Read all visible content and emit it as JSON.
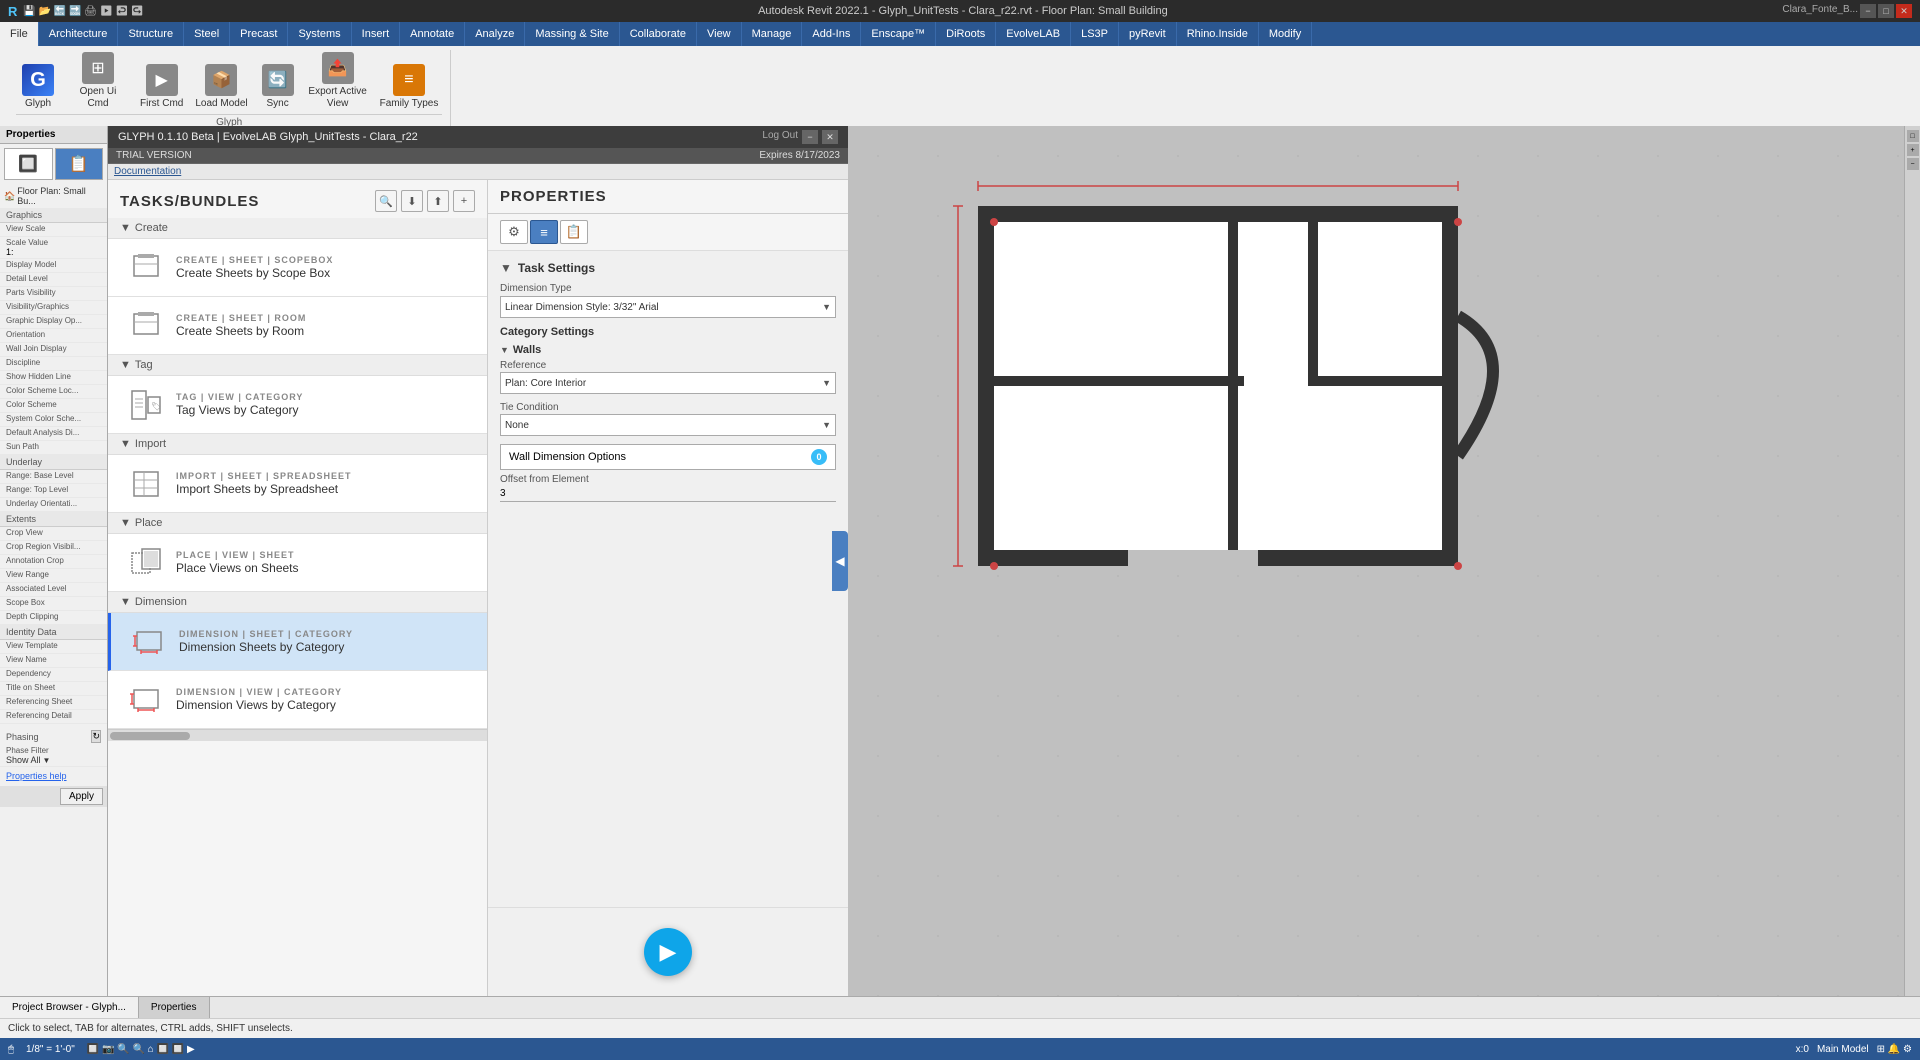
{
  "titlebar": {
    "title": "Autodesk Revit 2022.1 - Glyph_UnitTests - Clara_r22.rvt - Floor Plan: Small Building",
    "min_label": "−",
    "max_label": "□",
    "close_label": "✕",
    "user_label": "Clara_Fonte_B..."
  },
  "ribbon": {
    "tabs": [
      "File",
      "Architecture",
      "Structure",
      "Steel",
      "Precast",
      "Systems",
      "Insert",
      "Annotate",
      "Analyze",
      "Massing & Site",
      "Collaborate",
      "View",
      "Manage",
      "Add-Ins",
      "Enscape™",
      "DiRoots",
      "EvolveLAB",
      "LS3P",
      "pyRevit",
      "Rhino.Inside",
      "Modify"
    ],
    "active_tab": "File",
    "groups": [
      {
        "name": "Glyph",
        "items": [
          {
            "label": "Glyph",
            "icon": "G",
            "color": "blue"
          },
          {
            "label": "Open Ui Cmd",
            "icon": "⊞",
            "color": "gray"
          },
          {
            "label": "First Cmd",
            "icon": "▶",
            "color": "gray"
          },
          {
            "label": "Load Model",
            "icon": "📦",
            "color": "gray"
          },
          {
            "label": "Sync",
            "icon": "🔄",
            "color": "gray"
          },
          {
            "label": "Export Active View",
            "icon": "📤",
            "color": "gray"
          },
          {
            "label": "Family Types",
            "icon": "≡",
            "color": "orange"
          }
        ]
      }
    ]
  },
  "glyph_panel": {
    "header_left": "GLYPH 0.1.10 Beta | EvolveLAB  Glyph_UnitTests - Clara_r22",
    "header_right": "Log Out",
    "trial_label": "TRIAL VERSION",
    "expires_label": "Expires 8/17/2023",
    "nav_label": "Documentation",
    "min_btn": "−",
    "close_btn": "✕"
  },
  "tasks": {
    "title": "TASKS/BUNDLES",
    "toolbar_btns": [
      "🔍",
      "⬇",
      "⬆",
      "+"
    ],
    "sections": [
      {
        "name": "Create",
        "items": [
          {
            "category": "CREATE | SHEET | SCOPEBOX",
            "name": "Create Sheets by Scope Box",
            "icon": "📄"
          },
          {
            "category": "CREATE | SHEET | ROOM",
            "name": "Create Sheets by Room",
            "icon": "📄"
          }
        ]
      },
      {
        "name": "Tag",
        "items": [
          {
            "category": "TAG | VIEW | CATEGORY",
            "name": "Tag Views by Category",
            "icon": "🏷"
          }
        ]
      },
      {
        "name": "Import",
        "items": [
          {
            "category": "IMPORT | SHEET | SPREADSHEET",
            "name": "Import Sheets by Spreadsheet",
            "icon": "📊"
          }
        ]
      },
      {
        "name": "Place",
        "items": [
          {
            "category": "PLACE | VIEW | SHEET",
            "name": "Place Views on Sheets",
            "icon": "🗂"
          }
        ]
      },
      {
        "name": "Dimension",
        "items": [
          {
            "category": "DIMENSION | SHEET | CATEGORY",
            "name": "Dimension Sheets by Category",
            "icon": "📐",
            "active": true
          },
          {
            "category": "DIMENSION | VIEW | CATEGORY",
            "name": "Dimension Views by Category",
            "icon": "📐"
          }
        ]
      }
    ]
  },
  "properties": {
    "title": "PROPERTIES",
    "toolbar_btns": [
      {
        "icon": "⚙",
        "label": "settings",
        "active": false
      },
      {
        "icon": "≡",
        "label": "task-settings",
        "active": true
      },
      {
        "icon": "📋",
        "label": "export",
        "active": false
      }
    ],
    "task_settings": {
      "header": "Task Settings",
      "dimension_type_label": "Dimension Type",
      "dimension_type_value": "Linear Dimension Style: 3/32\" Arial",
      "category_settings_label": "Category Settings",
      "walls_label": "Walls",
      "reference_label": "Reference",
      "reference_value": "Plan: Core Interior",
      "tie_condition_label": "Tie Condition",
      "tie_condition_value": "None",
      "wall_dimension_options_label": "Wall Dimension Options",
      "wall_dimension_badge": "0",
      "offset_label": "Offset from Element",
      "offset_value": "3"
    },
    "run_btn_label": "▶"
  },
  "status_bar": {
    "message": "Click to select, TAB for alternates, CTRL adds, SHIFT unselects.",
    "scale": "1/8\" = 1'-0\"",
    "model": "Main Model",
    "left_items": [
      "Project Browser - Glyph...",
      "Properties"
    ],
    "bottom_props": [
      {
        "label": "Graphics"
      },
      {
        "label": "View Scale"
      },
      {
        "label": "Scale Value",
        "value": "1:"
      },
      {
        "label": "Display Model"
      },
      {
        "label": "Detail Level"
      },
      {
        "label": "Parts Visibility"
      },
      {
        "label": "Visibility/Graphics"
      },
      {
        "label": "Graphic Display Op..."
      },
      {
        "label": "Orientation"
      },
      {
        "label": "Wall Join Display"
      },
      {
        "label": "Discipline"
      },
      {
        "label": "Show Hidden Line"
      },
      {
        "label": "Color Scheme Loc..."
      },
      {
        "label": "Color Scheme"
      },
      {
        "label": "System Color Sche"
      },
      {
        "label": "Default Analysis Di..."
      },
      {
        "label": "Sun Path"
      },
      {
        "label": "Underlay"
      },
      {
        "label": "Range: Base Level"
      },
      {
        "label": "Range: Top Level"
      },
      {
        "label": "Underlay Orientati..."
      },
      {
        "label": "Extents"
      },
      {
        "label": "Crop View"
      },
      {
        "label": "Crop Region Visibil..."
      },
      {
        "label": "Annotation Crop"
      },
      {
        "label": "View Range"
      },
      {
        "label": "Associated Level"
      },
      {
        "label": "Scope Box"
      },
      {
        "label": "Depth Clipping"
      },
      {
        "label": "Identity Data"
      },
      {
        "label": "View Template"
      },
      {
        "label": "View Name"
      },
      {
        "label": "Dependency"
      },
      {
        "label": "Title on Sheet"
      },
      {
        "label": "Referencing Sheet"
      },
      {
        "label": "Referencing Detail"
      }
    ]
  },
  "left_panel": {
    "header": "Properties",
    "type_name": "Floor Plan: Small Bu..."
  }
}
